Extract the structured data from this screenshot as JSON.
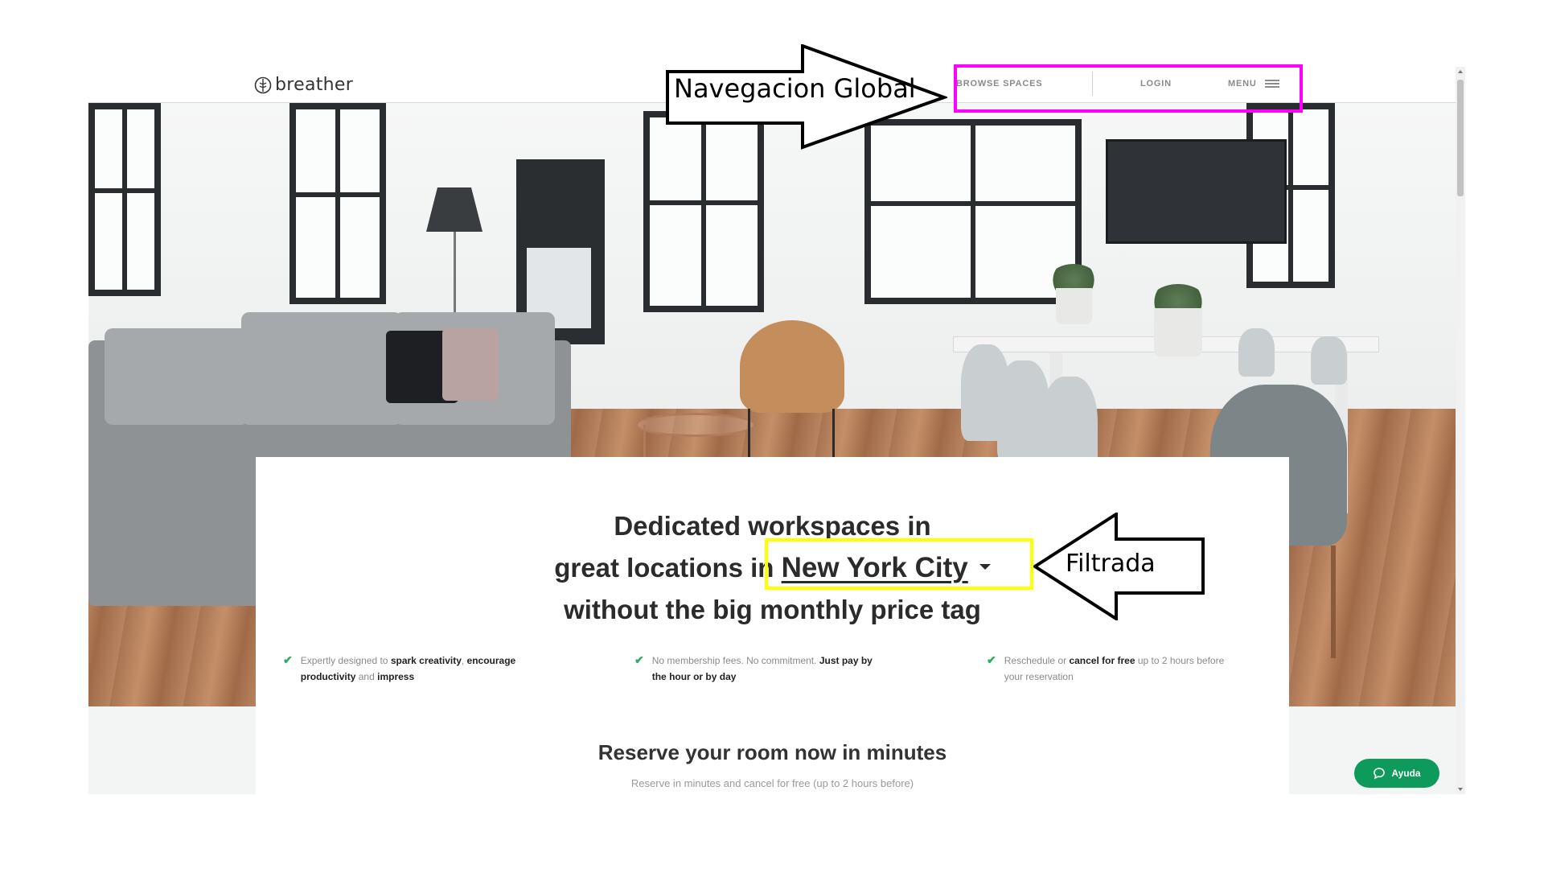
{
  "site": {
    "logo_text": "breather"
  },
  "nav": {
    "browse_label": "BROWSE SPACES",
    "login_label": "LOGIN",
    "menu_label": "MENU"
  },
  "hero": {
    "headline_line1": "Dedicated workspaces in",
    "headline_line2_prefix": "great locations in",
    "city": "New York City",
    "headline_line3": "without the big monthly price tag"
  },
  "features": [
    {
      "prefix": "Expertly designed to ",
      "bold1": "spark creativity",
      "mid": ", ",
      "bold2": "encourage productivity",
      "mid2": " and ",
      "bold3": "impress"
    },
    {
      "prefix": "No membership fees. No commitment. ",
      "bold1": "Just pay by the hour or by day"
    },
    {
      "prefix": "Reschedule or ",
      "bold1": "cancel for free",
      "suffix": " up to 2 hours before your reservation"
    }
  ],
  "reserve": {
    "title": "Reserve your room now in minutes",
    "subtitle": "Reserve in minutes and cancel for free (up to 2 hours before)"
  },
  "help": {
    "label": "Ayuda"
  },
  "annotations": {
    "nav_label": "Navegacion Global",
    "filter_label": "Filtrada",
    "nav_box_color": "#ff00ff",
    "filter_box_color": "#ffff00"
  },
  "colors": {
    "accent_green": "#0d9a5b",
    "check_green": "#2eaa5e"
  }
}
